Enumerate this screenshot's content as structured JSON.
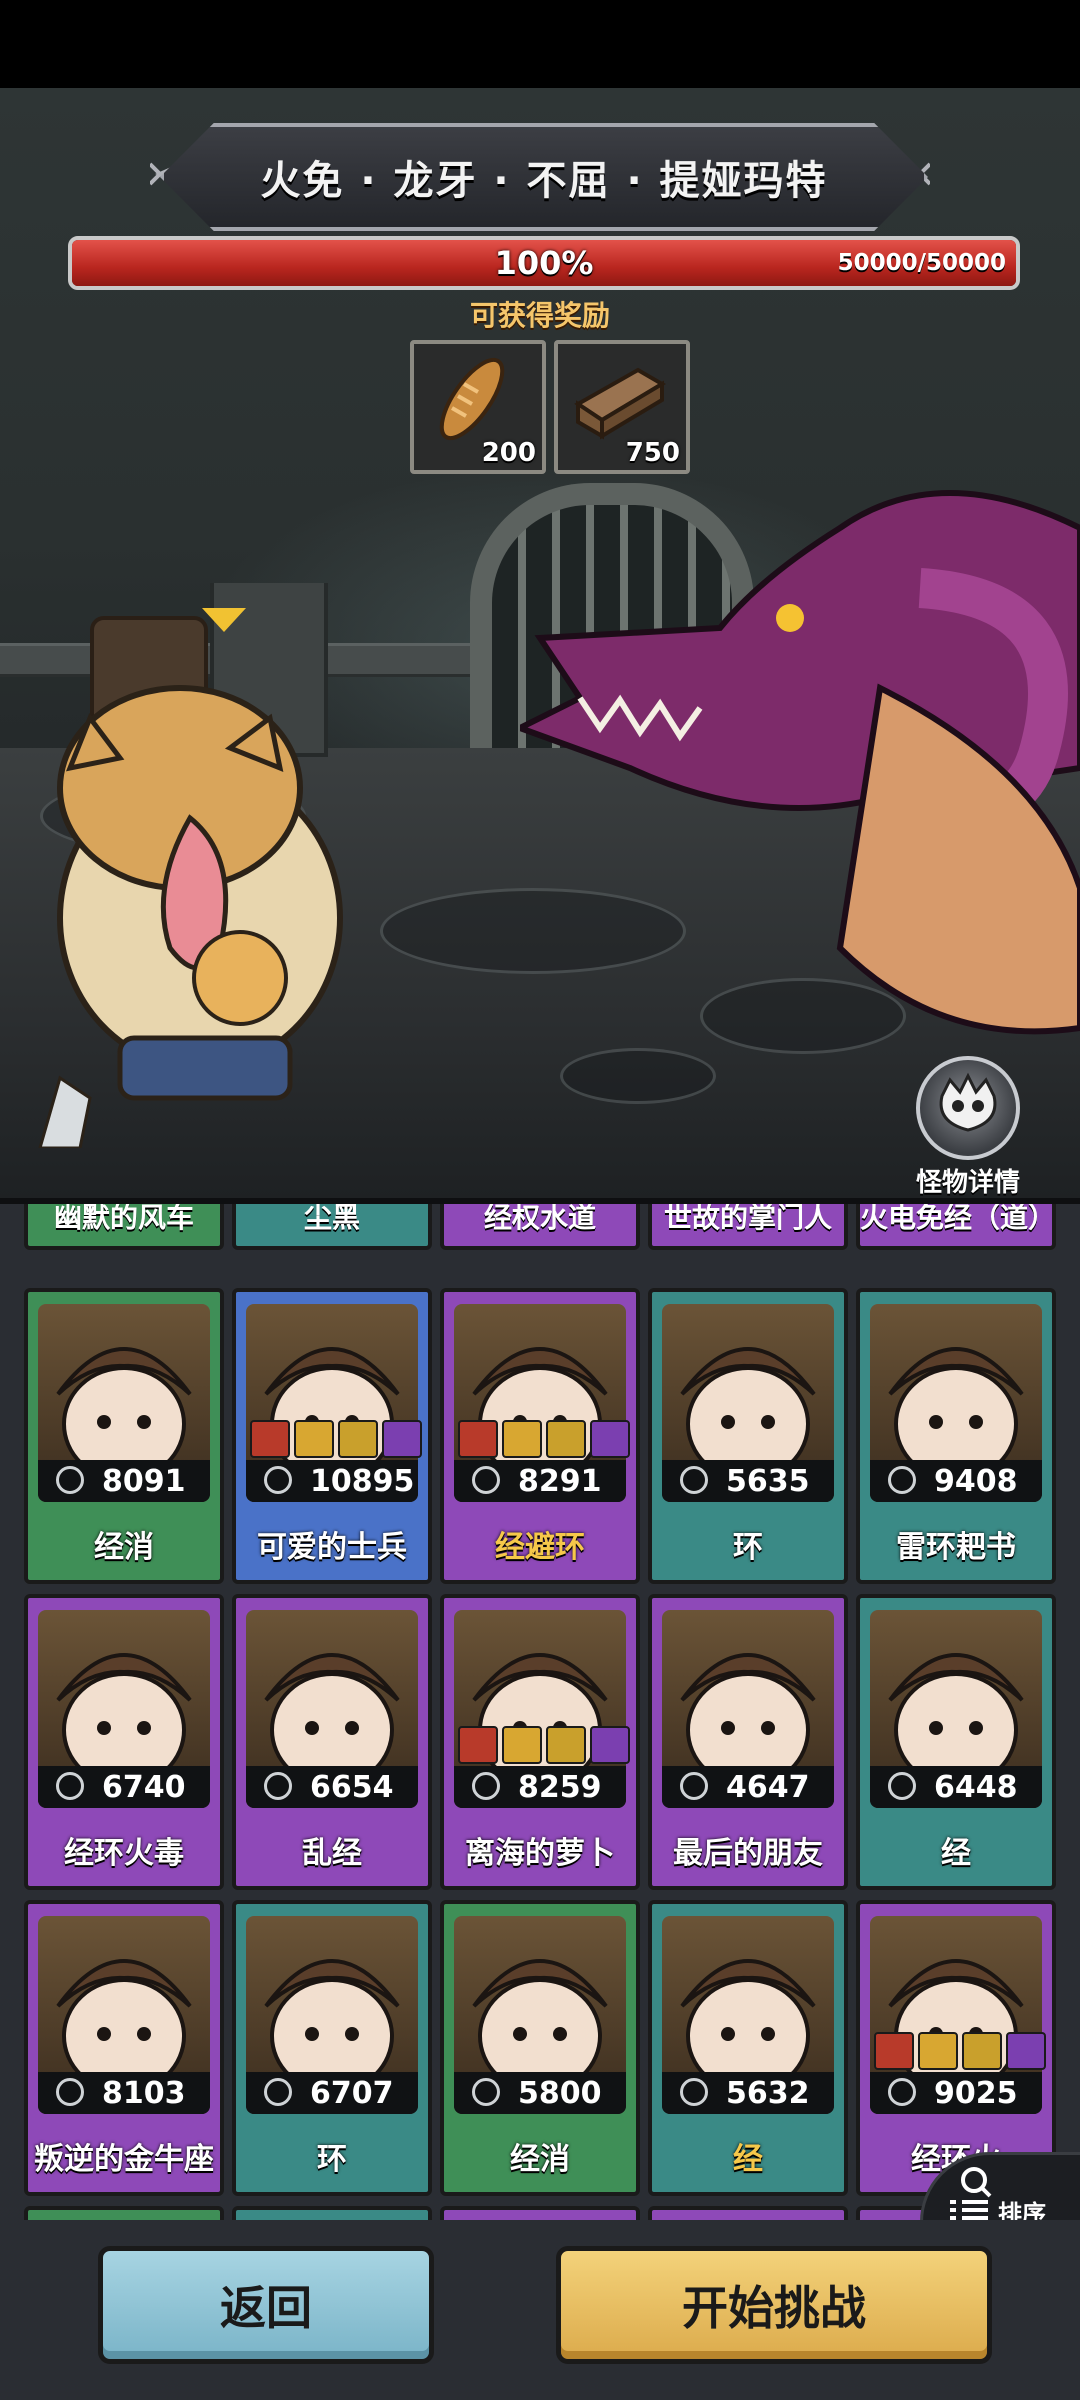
{
  "boss": {
    "name": "火免 · 龙牙 · 不屈 · 提娅玛特",
    "hp_percent_label": "100%",
    "hp_value": "50000/50000",
    "hp_fraction": 1.0
  },
  "rewards": {
    "label": "可获得奖励",
    "items": [
      {
        "icon": "bread-icon",
        "count": "200"
      },
      {
        "icon": "wood-log-icon",
        "count": "750"
      }
    ]
  },
  "monster_detail": {
    "label": "怪物详情",
    "icon": "monster-skull-icon"
  },
  "roster": {
    "top_row": [
      {
        "name": "幽默的风车",
        "rarity": "green"
      },
      {
        "name": "尘黑",
        "rarity": "teal"
      },
      {
        "name": "经权水道",
        "rarity": "purple"
      },
      {
        "name": "世故的掌门人",
        "rarity": "purple"
      },
      {
        "name": "火电免经（道）",
        "rarity": "purple"
      }
    ],
    "rows": [
      [
        {
          "name": "经消",
          "power": "8091",
          "rarity": "green",
          "portrait": "pumpkin-head-portrait",
          "gems": 0
        },
        {
          "name": "可爱的士兵",
          "power": "10895",
          "rarity": "blue",
          "portrait": "cowboy-hat-portrait",
          "gems": 4
        },
        {
          "name": "经避环",
          "power": "8291",
          "rarity": "purple",
          "portrait": "pumpkin-head-portrait",
          "gems": 4,
          "gold": true
        },
        {
          "name": "环",
          "power": "5635",
          "rarity": "teal",
          "portrait": "cat-ear-girl-portrait",
          "gems": 0
        },
        {
          "name": "雷环耙书",
          "power": "9408",
          "rarity": "teal",
          "portrait": "frog-hood-portrait",
          "gems": 0
        }
      ],
      [
        {
          "name": "经环火毒",
          "power": "6740",
          "rarity": "purple",
          "portrait": "frog-hood-portrait",
          "gems": 0
        },
        {
          "name": "乱经",
          "power": "6654",
          "rarity": "purple",
          "portrait": "goggles-bandit-portrait",
          "gems": 0
        },
        {
          "name": "离海的萝卜",
          "power": "8259",
          "rarity": "purple",
          "portrait": "red-helmet-portrait",
          "gems": 4
        },
        {
          "name": "最后的朋友",
          "power": "4647",
          "rarity": "purple",
          "portrait": "red-demon-portrait",
          "gems": 0
        },
        {
          "name": "经",
          "power": "6448",
          "rarity": "teal",
          "portrait": "goggles-bandit-portrait",
          "gems": 0
        }
      ],
      [
        {
          "name": "叛逆的金牛座",
          "power": "8103",
          "rarity": "purple",
          "portrait": "white-hair-warrior-portrait",
          "gems": 0
        },
        {
          "name": "环",
          "power": "6707",
          "rarity": "teal",
          "portrait": "chicken-hood-portrait",
          "gems": 0
        },
        {
          "name": "经消",
          "power": "5800",
          "rarity": "green",
          "portrait": "cowboy-hat-portrait",
          "gems": 0
        },
        {
          "name": "经",
          "power": "5632",
          "rarity": "teal",
          "portrait": "hippo-hood-portrait",
          "gems": 0,
          "gold": true
        },
        {
          "name": "经环火",
          "power": "9025",
          "rarity": "purple",
          "portrait": "goggles-bandit-portrait",
          "gems": 4
        }
      ]
    ]
  },
  "sort": {
    "label": "排序",
    "icon": "search-list-icon"
  },
  "buttons": {
    "back": "返回",
    "start": "开始挑战"
  },
  "colors": {
    "green": "#3f8f57",
    "blue": "#4a72c8",
    "purple": "#8e49b8",
    "teal": "#3a8a86",
    "hp_red": "#c93a31",
    "reward_gold": "#f5c66b",
    "back_button": "#8fc3d5",
    "start_button": "#e8bf63"
  }
}
